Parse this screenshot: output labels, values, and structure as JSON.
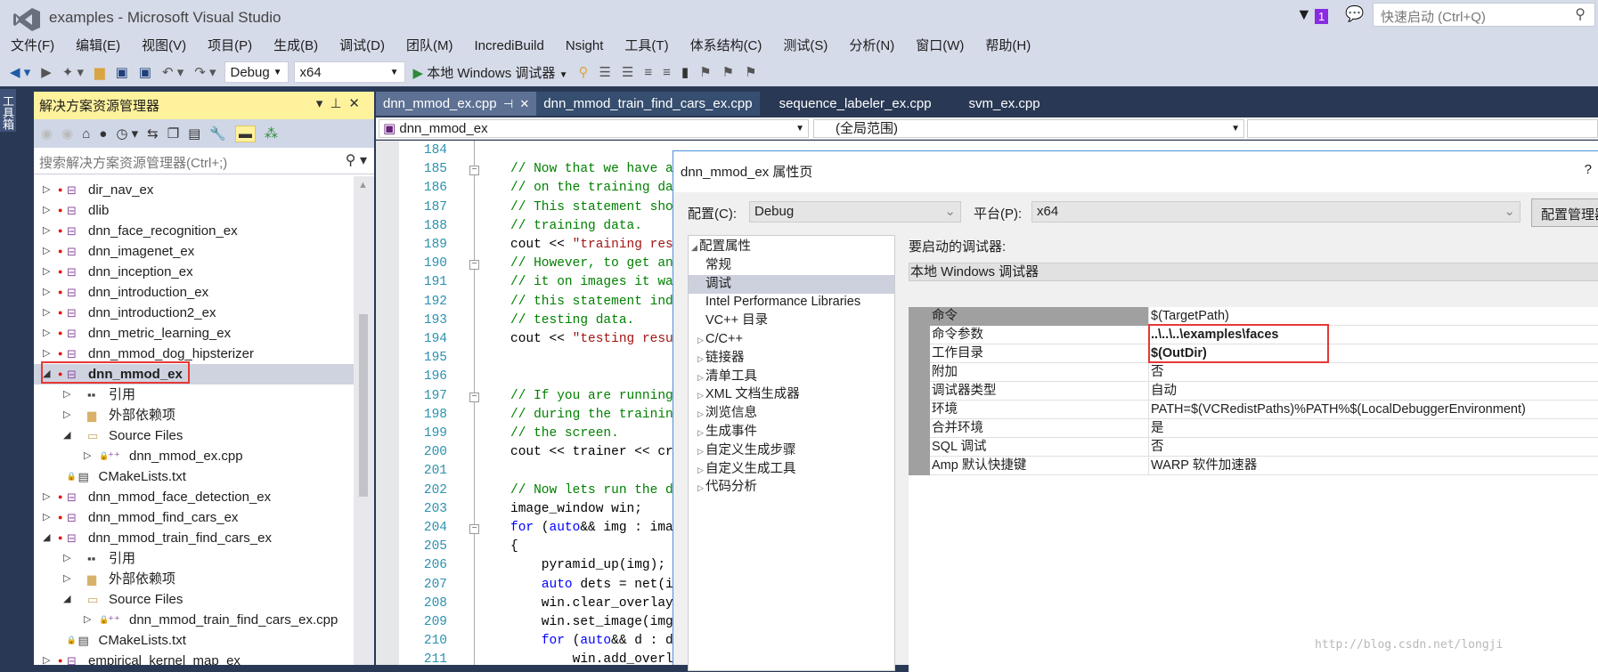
{
  "window": {
    "title": "examples - Microsoft Visual Studio"
  },
  "top_right": {
    "notification_count": "1",
    "quick_launch_placeholder": "快速启动 (Ctrl+Q)",
    "badge_color": "#8a2be2"
  },
  "menu": [
    "文件(F)",
    "编辑(E)",
    "视图(V)",
    "项目(P)",
    "生成(B)",
    "调试(D)",
    "团队(M)",
    "IncrediBuild",
    "Nsight",
    "工具(T)",
    "体系结构(C)",
    "测试(S)",
    "分析(N)",
    "窗口(W)",
    "帮助(H)"
  ],
  "toolbar": {
    "config": "Debug",
    "platform": "x64",
    "start_debugger": "本地 Windows 调试器"
  },
  "toolbox": {
    "label": "工具箱"
  },
  "solution_explorer": {
    "title": "解决方案资源管理器",
    "search_placeholder": "搜索解决方案资源管理器(Ctrl+;)",
    "items": [
      {
        "label": "dir_nav_ex",
        "level": 0,
        "expander": "closed",
        "icon": "project"
      },
      {
        "label": "dlib",
        "level": 0,
        "expander": "closed",
        "icon": "project"
      },
      {
        "label": "dnn_face_recognition_ex",
        "level": 0,
        "expander": "closed",
        "icon": "project"
      },
      {
        "label": "dnn_imagenet_ex",
        "level": 0,
        "expander": "closed",
        "icon": "project"
      },
      {
        "label": "dnn_inception_ex",
        "level": 0,
        "expander": "closed",
        "icon": "project"
      },
      {
        "label": "dnn_introduction_ex",
        "level": 0,
        "expander": "closed",
        "icon": "project"
      },
      {
        "label": "dnn_introduction2_ex",
        "level": 0,
        "expander": "closed",
        "icon": "project"
      },
      {
        "label": "dnn_metric_learning_ex",
        "level": 0,
        "expander": "closed",
        "icon": "project"
      },
      {
        "label": "dnn_mmod_dog_hipsterizer",
        "level": 0,
        "expander": "closed",
        "icon": "project"
      },
      {
        "label": "dnn_mmod_ex",
        "level": 0,
        "expander": "open",
        "icon": "project",
        "selected": true,
        "bold": true
      },
      {
        "label": "引用",
        "level": 1,
        "expander": "closed",
        "icon": "references"
      },
      {
        "label": "外部依赖项",
        "level": 1,
        "expander": "closed",
        "icon": "external-folder"
      },
      {
        "label": "Source Files",
        "level": 1,
        "expander": "open",
        "icon": "filter-folder"
      },
      {
        "label": "dnn_mmod_ex.cpp",
        "level": 2,
        "expander": "closed",
        "icon": "cpp-file"
      },
      {
        "label": "CMakeLists.txt",
        "level": 1.5,
        "expander": "none",
        "icon": "text-file"
      },
      {
        "label": "dnn_mmod_face_detection_ex",
        "level": 0,
        "expander": "closed",
        "icon": "project"
      },
      {
        "label": "dnn_mmod_find_cars_ex",
        "level": 0,
        "expander": "closed",
        "icon": "project"
      },
      {
        "label": "dnn_mmod_train_find_cars_ex",
        "level": 0,
        "expander": "open",
        "icon": "project"
      },
      {
        "label": "引用",
        "level": 1,
        "expander": "closed",
        "icon": "references"
      },
      {
        "label": "外部依赖项",
        "level": 1,
        "expander": "closed",
        "icon": "external-folder"
      },
      {
        "label": "Source Files",
        "level": 1,
        "expander": "open",
        "icon": "filter-folder"
      },
      {
        "label": "dnn_mmod_train_find_cars_ex.cpp",
        "level": 2,
        "expander": "closed",
        "icon": "cpp-file"
      },
      {
        "label": "CMakeLists.txt",
        "level": 1.5,
        "expander": "none",
        "icon": "text-file"
      },
      {
        "label": "empirical_kernel_map_ex",
        "level": 0,
        "expander": "closed",
        "icon": "project"
      }
    ]
  },
  "editor": {
    "tabs": [
      {
        "label": "dnn_mmod_ex.cpp",
        "active": true
      },
      {
        "label": "dnn_mmod_train_find_cars_ex.cpp"
      },
      {
        "label": "sequence_labeler_ex.cpp"
      },
      {
        "label": "svm_ex.cpp"
      }
    ],
    "nav_project": "dnn_mmod_ex",
    "nav_scope": "(全局范围)",
    "lines": [
      {
        "n": "184",
        "s": []
      },
      {
        "n": "185",
        "fold": true,
        "s": [
          [
            "com",
            "// Now that we have a"
          ]
        ]
      },
      {
        "n": "186",
        "s": [
          [
            "com",
            "// on the training dat"
          ]
        ]
      },
      {
        "n": "187",
        "s": [
          [
            "com",
            "// This statement shou"
          ]
        ]
      },
      {
        "n": "188",
        "s": [
          [
            "com",
            "// training data."
          ]
        ]
      },
      {
        "n": "189",
        "s": [
          [
            "plain",
            "cout << "
          ],
          [
            "str",
            "\"training resu"
          ]
        ]
      },
      {
        "n": "190",
        "fold": true,
        "s": [
          [
            "com",
            "// However, to get an"
          ]
        ]
      },
      {
        "n": "191",
        "s": [
          [
            "com",
            "// it on images it was"
          ]
        ]
      },
      {
        "n": "192",
        "s": [
          [
            "com",
            "// this statement indi"
          ]
        ]
      },
      {
        "n": "193",
        "s": [
          [
            "com",
            "// testing data."
          ]
        ]
      },
      {
        "n": "194",
        "s": [
          [
            "plain",
            "cout << "
          ],
          [
            "str",
            "\"testing resul"
          ]
        ]
      },
      {
        "n": "195",
        "s": []
      },
      {
        "n": "196",
        "s": []
      },
      {
        "n": "197",
        "fold": true,
        "s": [
          [
            "com",
            "// If you are running"
          ]
        ]
      },
      {
        "n": "198",
        "s": [
          [
            "com",
            "// during the training"
          ]
        ]
      },
      {
        "n": "199",
        "s": [
          [
            "com",
            "// the screen."
          ]
        ]
      },
      {
        "n": "200",
        "s": [
          [
            "plain",
            "cout << trainer << cro"
          ]
        ]
      },
      {
        "n": "201",
        "s": []
      },
      {
        "n": "202",
        "s": [
          [
            "com",
            "// Now lets run the de"
          ]
        ]
      },
      {
        "n": "203",
        "s": [
          [
            "plain",
            "image_window win;"
          ]
        ]
      },
      {
        "n": "204",
        "fold": true,
        "s": [
          [
            "kw",
            "for"
          ],
          [
            "plain",
            " ("
          ],
          [
            "kw",
            "auto"
          ],
          [
            "plain",
            "&& img : imag"
          ]
        ]
      },
      {
        "n": "205",
        "s": [
          [
            "plain",
            "{"
          ]
        ]
      },
      {
        "n": "206",
        "s": [
          [
            "plain",
            "    pyramid_up(img);"
          ]
        ]
      },
      {
        "n": "207",
        "s": [
          [
            "plain",
            "    "
          ],
          [
            "kw",
            "auto"
          ],
          [
            "plain",
            " dets = net(im"
          ]
        ]
      },
      {
        "n": "208",
        "s": [
          [
            "plain",
            "    win.clear_overlay("
          ]
        ]
      },
      {
        "n": "209",
        "s": [
          [
            "plain",
            "    win.set_image(img)"
          ]
        ]
      },
      {
        "n": "210",
        "s": [
          [
            "plain",
            "    "
          ],
          [
            "kw",
            "for"
          ],
          [
            "plain",
            " ("
          ],
          [
            "kw",
            "auto"
          ],
          [
            "plain",
            "&& d : de"
          ]
        ]
      },
      {
        "n": "211",
        "s": [
          [
            "plain",
            "        win.add_overla"
          ]
        ]
      }
    ]
  },
  "dialog": {
    "title": "dnn_mmod_ex 属性页",
    "help": "?",
    "config_label": "配置(C):",
    "config_value": "Debug",
    "platform_label": "平台(P):",
    "platform_value": "x64",
    "config_manager": "配置管理器(O)...",
    "tree": [
      {
        "label": "配置属性",
        "level": 0,
        "expander": "open"
      },
      {
        "label": "常规",
        "level": 1
      },
      {
        "label": "调试",
        "level": 1,
        "selected": true
      },
      {
        "label": "Intel Performance Libraries",
        "level": 1
      },
      {
        "label": "VC++ 目录",
        "level": 1
      },
      {
        "label": "C/C++",
        "level": 1,
        "expander": "closed"
      },
      {
        "label": "链接器",
        "level": 1,
        "expander": "closed"
      },
      {
        "label": "清单工具",
        "level": 1,
        "expander": "closed"
      },
      {
        "label": "XML 文档生成器",
        "level": 1,
        "expander": "closed"
      },
      {
        "label": "浏览信息",
        "level": 1,
        "expander": "closed"
      },
      {
        "label": "生成事件",
        "level": 1,
        "expander": "closed"
      },
      {
        "label": "自定义生成步骤",
        "level": 1,
        "expander": "closed"
      },
      {
        "label": "自定义生成工具",
        "level": 1,
        "expander": "closed"
      },
      {
        "label": "代码分析",
        "level": 1,
        "expander": "closed"
      }
    ],
    "debugger_label": "要启动的调试器:",
    "debugger_value": "本地 Windows 调试器",
    "properties": [
      {
        "name": "命令",
        "value": "$(TargetPath)"
      },
      {
        "name": "命令参数",
        "value": "..\\..\\..\\examples\\faces",
        "bold": true
      },
      {
        "name": "工作目录",
        "value": "$(OutDir)",
        "bold": true
      },
      {
        "name": "附加",
        "value": "否"
      },
      {
        "name": "调试器类型",
        "value": "自动"
      },
      {
        "name": "环境",
        "value": "PATH=$(VCRedistPaths)%PATH%$(LocalDebuggerEnvironment)"
      },
      {
        "name": "合并环境",
        "value": "是"
      },
      {
        "name": "SQL 调试",
        "value": "否"
      },
      {
        "name": "Amp 默认快捷键",
        "value": "WARP 软件加速器"
      }
    ]
  },
  "watermark": "http://blog.csdn.net/longji",
  "colors": {
    "highlight_box": "#e53935",
    "comment": "#008000",
    "string": "#a31515",
    "keyword": "#0000ff",
    "line_number": "#2b91af"
  }
}
